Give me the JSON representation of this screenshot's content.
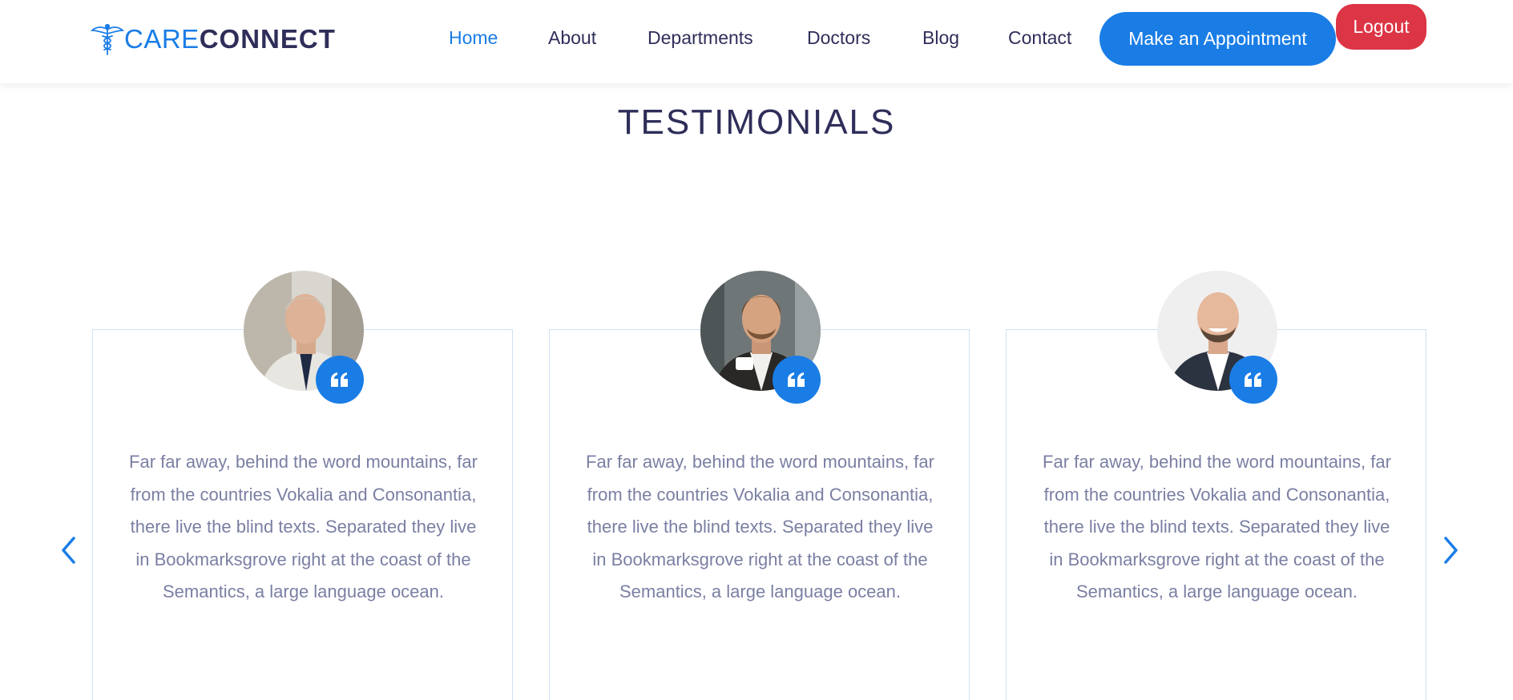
{
  "brand": {
    "part1": "CARE",
    "part2": "CONNECT",
    "logo_icon": "caduceus-icon",
    "color_primary": "#1a7de6",
    "color_dark": "#2f2e5a"
  },
  "nav": {
    "items": [
      {
        "label": "Home",
        "active": true
      },
      {
        "label": "About",
        "active": false
      },
      {
        "label": "Departments",
        "active": false
      },
      {
        "label": "Doctors",
        "active": false
      },
      {
        "label": "Blog",
        "active": false
      },
      {
        "label": "Contact",
        "active": false
      }
    ],
    "appointment_label": "Make an Appointment",
    "logout_label": "Logout",
    "logout_color": "#dc3545"
  },
  "testimonials": {
    "title": "TESTIMONIALS",
    "quote_icon": "quote-left-icon",
    "items": [
      {
        "text": "Far far away, behind the word mountains, far from the countries Vokalia and Consonantia, there live the blind texts. Separated they live in Bookmarksgrove right at the coast of the Semantics, a large language ocean."
      },
      {
        "text": "Far far away, behind the word mountains, far from the countries Vokalia and Consonantia, there live the blind texts. Separated they live in Bookmarksgrove right at the coast of the Semantics, a large language ocean."
      },
      {
        "text": "Far far away, behind the word mountains, far from the countries Vokalia and Consonantia, there live the blind texts. Separated they live in Bookmarksgrove right at the coast of the Semantics, a large language ocean."
      }
    ],
    "prev_icon": "chevron-left-icon",
    "next_icon": "chevron-right-icon"
  }
}
